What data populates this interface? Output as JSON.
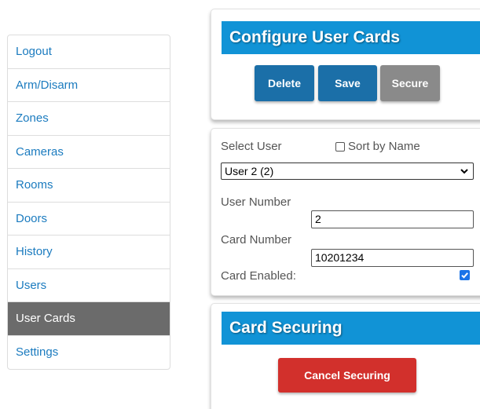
{
  "sidebar": {
    "items": [
      {
        "label": "Logout"
      },
      {
        "label": "Arm/Disarm"
      },
      {
        "label": "Zones"
      },
      {
        "label": "Cameras"
      },
      {
        "label": "Rooms"
      },
      {
        "label": "Doors"
      },
      {
        "label": "History"
      },
      {
        "label": "Users"
      },
      {
        "label": "User Cards",
        "active": true
      },
      {
        "label": "Settings"
      }
    ]
  },
  "configure": {
    "title": "Configure User Cards",
    "delete_label": "Delete",
    "save_label": "Save",
    "secure_label": "Secure"
  },
  "form": {
    "select_user_label": "Select User",
    "sort_by_name_label": "Sort by Name",
    "sort_by_name_checked": false,
    "selected_user": "User 2 (2)",
    "user_number_label": "User Number",
    "user_number_value": "2",
    "card_number_label": "Card Number",
    "card_number_value": "10201234",
    "card_enabled_label": "Card Enabled:",
    "card_enabled_checked": true
  },
  "securing": {
    "title": "Card Securing",
    "cancel_label": "Cancel Securing"
  },
  "colors": {
    "header_blue": "#1193d6",
    "button_blue": "#1b6fa8",
    "button_gray": "#8a8a8a",
    "button_red": "#d2302c",
    "active_nav": "#6b6b6b",
    "link": "#1b7bbf",
    "checkbox": "#1a73e8"
  }
}
